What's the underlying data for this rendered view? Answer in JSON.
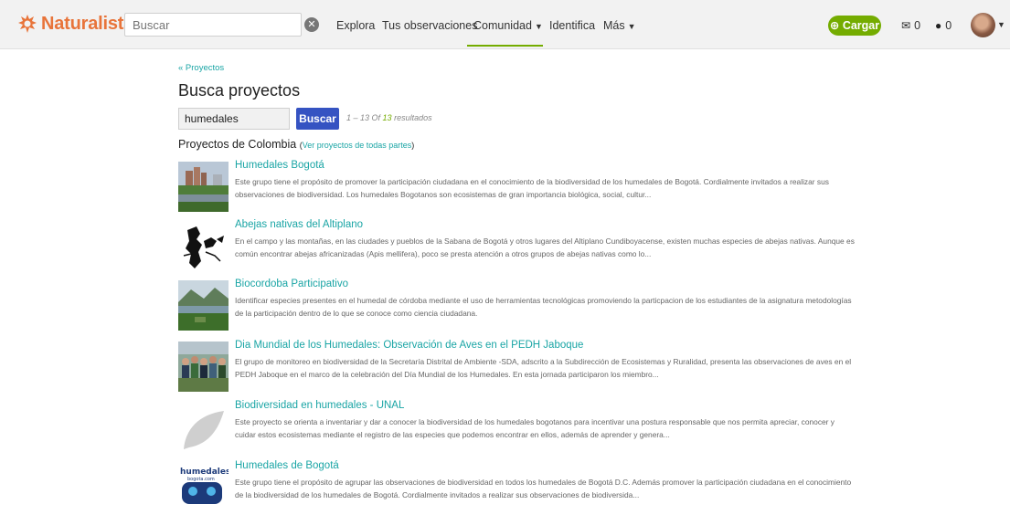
{
  "header": {
    "logo_text": "Naturalista",
    "search_placeholder": "Buscar",
    "nav": [
      {
        "label": "Explora",
        "caret": false
      },
      {
        "label": "Tus observaciones",
        "caret": false
      },
      {
        "label": "Comunidad",
        "caret": true,
        "active": true
      },
      {
        "label": "Identifica",
        "caret": false
      },
      {
        "label": "Más",
        "caret": true
      }
    ],
    "upload_label": "Cargar",
    "messages_count": "0",
    "notifications_count": "0"
  },
  "page": {
    "back_link": "« Proyectos",
    "title": "Busca proyectos",
    "query": "humedales",
    "search_button": "Buscar",
    "results_prefix": "1 – 13 Of",
    "results_total": "13",
    "results_suffix": "resultados",
    "section_title": "Proyectos de Colombia",
    "section_paren_open": "(",
    "section_link": "Ver proyectos de todas partes",
    "section_paren_close": ")"
  },
  "projects": [
    {
      "title": "Humedales Bogotá",
      "thumb": "wetland-city-photo",
      "description": "Este grupo tiene el propósito de promover la participación ciudadana en el conocimiento de la biodiversidad de los humedales de Bogotá. Cordialmente invitados a realizar sus observaciones de biodiversidad. Los humedales Bogotanos son ecosistemas de gran importancia biológica, social, cultur..."
    },
    {
      "title": "Abejas nativas del Altiplano",
      "thumb": "bee-map-silhouette",
      "description": "En el campo y las montañas, en las ciudades y pueblos de la Sabana de Bogotá y otros lugares del Altiplano Cundiboyacense, existen muchas especies de abejas nativas. Aunque es común encontrar abejas africanizadas (Apis mellifera), poco se presta atención a otros grupos de abejas nativas como lo..."
    },
    {
      "title": "Biocordoba Participativo",
      "thumb": "wetland-mountain-photo",
      "description": "Identificar especies presentes en el humedal de córdoba mediante el uso de herramientas tecnológicas promoviendo la particpacion de los estudiantes de la asignatura metodologías de la participación dentro de lo que se conoce como ciencia ciudadana."
    },
    {
      "title": "Dia Mundial de los Humedales: Observación de Aves en el PEDH Jaboque",
      "thumb": "group-photo",
      "description": "El grupo de monitoreo en biodiversidad de la Secretaría Distrital de Ambiente -SDA, adscrito a la Subdirección de Ecosistemas y Ruralidad, presenta las observaciones de aves en el PEDH Jaboque en el marco de la celebración del Día Mundial de los Humedales. En esta jornada participaron los miembro..."
    },
    {
      "title": "Biodiversidad en humedales - UNAL",
      "thumb": "leaf-placeholder-icon",
      "description": "Este proyecto se orienta a inventariar y dar a conocer la biodiversidad de los humedales bogotanos para incentivar una postura responsable que nos permita apreciar, conocer y cuidar estos ecosistemas mediante el registro de las especies que podemos encontrar en ellos, además de aprender y genera..."
    },
    {
      "title": "Humedales de Bogotá",
      "thumb": "humedales-logo",
      "logo_word": "humedales",
      "logo_sub": "bogota.com",
      "description": "Este grupo tiene el propósito de agrupar las observaciones de biodiversidad en todos los humedales de Bogotá D.C. Además promover la participación ciudadana en el conocimiento de la biodiversidad de los humedales de Bogotá. Cordialmente invitados a realizar sus observaciones de biodiversida..."
    }
  ],
  "colors": {
    "brand_orange": "#e8743a",
    "brand_green": "#74ac00",
    "link_teal": "#1aa5a5",
    "button_blue": "#3553c2"
  }
}
